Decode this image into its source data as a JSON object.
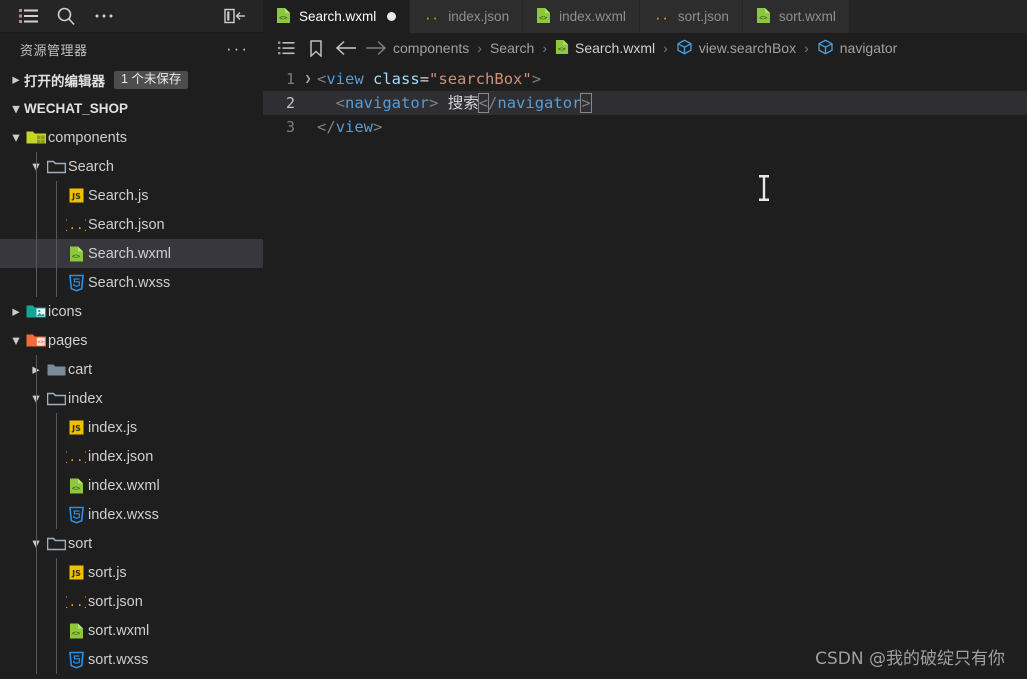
{
  "titlebar": {
    "icons": [
      {
        "name": "list-icon",
        "glyph": "list"
      },
      {
        "name": "search-icon",
        "glyph": "search"
      },
      {
        "name": "more-icon",
        "glyph": "ellipsis"
      }
    ],
    "right_icon": {
      "name": "toggle-panel-icon",
      "glyph": "panel-left"
    }
  },
  "tabs": [
    {
      "label": "Search.wxml",
      "icon": "wxml-file-icon",
      "active": true,
      "dirty": true
    },
    {
      "label": "index.json",
      "icon": "json-file-icon",
      "active": false,
      "dirty": false
    },
    {
      "label": "index.wxml",
      "icon": "wxml-file-icon",
      "active": false,
      "dirty": false
    },
    {
      "label": "sort.json",
      "icon": "json-file-icon",
      "active": false,
      "dirty": false
    },
    {
      "label": "sort.wxml",
      "icon": "wxml-file-icon",
      "active": false,
      "dirty": false
    }
  ],
  "sidebar": {
    "title": "资源管理器",
    "more_label": "···",
    "open_editors": {
      "label": "打开的编辑器",
      "badge": "1 个未保存",
      "expanded": false
    },
    "workspace": {
      "label": "WECHAT_SHOP",
      "expanded": true
    },
    "tree": [
      {
        "label": "components",
        "type": "folder",
        "icon": "folder-components-icon",
        "depth": 1,
        "expanded": true,
        "selected": false
      },
      {
        "label": "Search",
        "type": "folder",
        "icon": "folder-open-icon",
        "depth": 2,
        "expanded": true,
        "selected": false
      },
      {
        "label": "Search.js",
        "type": "file",
        "icon": "js-file-icon",
        "depth": 3,
        "selected": false
      },
      {
        "label": "Search.json",
        "type": "file",
        "icon": "json-file-icon",
        "depth": 3,
        "selected": false
      },
      {
        "label": "Search.wxml",
        "type": "file",
        "icon": "wxml-file-icon",
        "depth": 3,
        "selected": true
      },
      {
        "label": "Search.wxss",
        "type": "file",
        "icon": "wxss-file-icon",
        "depth": 3,
        "selected": false
      },
      {
        "label": "icons",
        "type": "folder",
        "icon": "folder-images-icon",
        "depth": 1,
        "expanded": false,
        "selected": false
      },
      {
        "label": "pages",
        "type": "folder",
        "icon": "folder-views-icon",
        "depth": 1,
        "expanded": true,
        "selected": false
      },
      {
        "label": "cart",
        "type": "folder",
        "icon": "folder-closed-icon",
        "depth": 2,
        "expanded": false,
        "selected": false
      },
      {
        "label": "index",
        "type": "folder",
        "icon": "folder-open-icon",
        "depth": 2,
        "expanded": true,
        "selected": false
      },
      {
        "label": "index.js",
        "type": "file",
        "icon": "js-file-icon",
        "depth": 3,
        "selected": false
      },
      {
        "label": "index.json",
        "type": "file",
        "icon": "json-file-icon",
        "depth": 3,
        "selected": false
      },
      {
        "label": "index.wxml",
        "type": "file",
        "icon": "wxml-file-icon",
        "depth": 3,
        "selected": false
      },
      {
        "label": "index.wxss",
        "type": "file",
        "icon": "wxss-file-icon",
        "depth": 3,
        "selected": false
      },
      {
        "label": "sort",
        "type": "folder",
        "icon": "folder-open-icon",
        "depth": 2,
        "expanded": true,
        "selected": false
      },
      {
        "label": "sort.js",
        "type": "file",
        "icon": "js-file-icon",
        "depth": 3,
        "selected": false
      },
      {
        "label": "sort.json",
        "type": "file",
        "icon": "json-file-icon",
        "depth": 3,
        "selected": false
      },
      {
        "label": "sort.wxml",
        "type": "file",
        "icon": "wxml-file-icon",
        "depth": 3,
        "selected": false
      },
      {
        "label": "sort.wxss",
        "type": "file",
        "icon": "wxss-file-icon",
        "depth": 3,
        "selected": false
      }
    ]
  },
  "breadcrumb": {
    "toolbar_icons": [
      {
        "name": "outline-list-icon"
      },
      {
        "name": "bookmark-icon"
      },
      {
        "name": "back-arrow-icon"
      },
      {
        "name": "forward-arrow-icon"
      }
    ],
    "items": [
      {
        "label": "components",
        "icon": null
      },
      {
        "label": "Search",
        "icon": null
      },
      {
        "label": "Search.wxml",
        "icon": "wxml-file-icon"
      },
      {
        "label": "view.searchBox",
        "icon": "symbol-cube-icon"
      },
      {
        "label": "navigator",
        "icon": "symbol-cube-icon"
      }
    ],
    "separator": "›"
  },
  "code": {
    "language": "wxml",
    "lines": [
      {
        "number": "1",
        "foldable": true,
        "current": false
      },
      {
        "number": "2",
        "foldable": false,
        "current": true
      },
      {
        "number": "3",
        "foldable": false,
        "current": false
      }
    ],
    "line1": {
      "open": "<",
      "tag": "view",
      "space": " ",
      "attr": "class",
      "eq": "=",
      "quote_open": "\"",
      "value": "searchBox",
      "quote_close": "\"",
      "close": ">"
    },
    "line2": {
      "indent": "  ",
      "open": "<",
      "tag": "navigator",
      "close": ">",
      "content": " 搜索",
      "end_open": "<",
      "end_slash": "/",
      "end_tag": "navigator",
      "end_close": ">"
    },
    "line3": {
      "indent": "",
      "open": "<",
      "slash": "/",
      "tag": "view",
      "close": ">"
    }
  },
  "watermark": "CSDN @我的破绽只有你",
  "colors": {
    "editor_bg": "#1e1e1e",
    "tabbar_bg": "#252526",
    "tab_inactive_bg": "#2d2d2d",
    "selected_row_bg": "#37373d",
    "current_line_bg": "#2f2f33",
    "tag_blue": "#569cd6",
    "attr_blue": "#9cdcfe",
    "string_orange": "#ce9178",
    "text_white": "#d4d4d4"
  }
}
